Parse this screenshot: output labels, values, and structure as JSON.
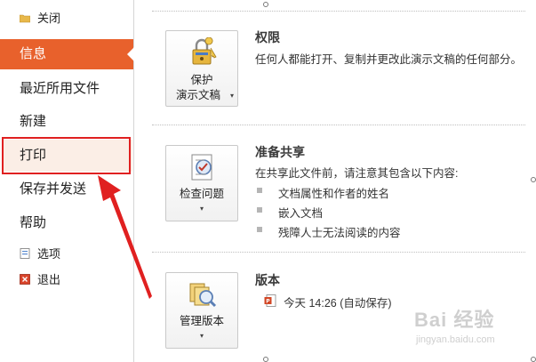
{
  "sidebar": {
    "close_label": "关闭",
    "info_label": "信息",
    "recent_label": "最近所用文件",
    "new_label": "新建",
    "print_label": "打印",
    "save_send_label": "保存并发送",
    "help_label": "帮助",
    "options_label": "选项",
    "exit_label": "退出"
  },
  "sections": {
    "permissions": {
      "button_line1": "保护",
      "button_line2": "演示文稿",
      "title": "权限",
      "desc": "任何人都能打开、复制并更改此演示文稿的任何部分。"
    },
    "prepare": {
      "button_label": "检查问题",
      "title": "准备共享",
      "desc": "在共享此文件前，请注意其包含以下内容:",
      "bullets": [
        "文档属性和作者的姓名",
        "嵌入文档",
        "残障人士无法阅读的内容"
      ]
    },
    "versions": {
      "button_label": "管理版本",
      "title": "版本",
      "entry": "今天 14:26 (自动保存)"
    }
  },
  "watermark": {
    "brand": "Bai 经验",
    "url": "jingyan.baidu.com"
  },
  "colors": {
    "accent": "#e8612c",
    "highlight_border": "#e02020"
  }
}
